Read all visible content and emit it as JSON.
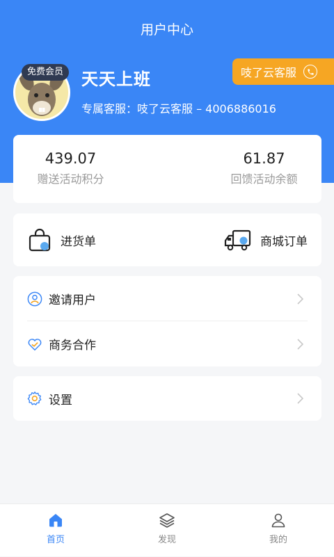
{
  "colors": {
    "primary": "#3a86f6",
    "accent": "#f6a623",
    "background": "#f5f6f8"
  },
  "header": {
    "title": "用户中心"
  },
  "profile": {
    "badge": "免费会员",
    "username": "天天上班",
    "service_line": "专属客服：吱了云客服 – 4006886016",
    "service_button": {
      "label": "吱了云客服",
      "icon": "phone-icon"
    }
  },
  "stats": [
    {
      "value": "439.07",
      "label": "赠送活动积分"
    },
    {
      "value": "61.87",
      "label": "回馈活动余额"
    }
  ],
  "orders": [
    {
      "label": "进货单",
      "icon": "shopping-bag-icon"
    },
    {
      "label": "商城订单",
      "icon": "truck-icon"
    }
  ],
  "menu": [
    {
      "label": "邀请用户",
      "icon": "user-circle-icon"
    },
    {
      "label": "商务合作",
      "icon": "handshake-heart-icon"
    },
    {
      "label": "设置",
      "icon": "gear-icon"
    }
  ],
  "tabbar": [
    {
      "label": "首页",
      "icon": "home-icon",
      "active": true
    },
    {
      "label": "发现",
      "icon": "layers-icon",
      "active": false
    },
    {
      "label": "我的",
      "icon": "person-icon",
      "active": false
    }
  ]
}
